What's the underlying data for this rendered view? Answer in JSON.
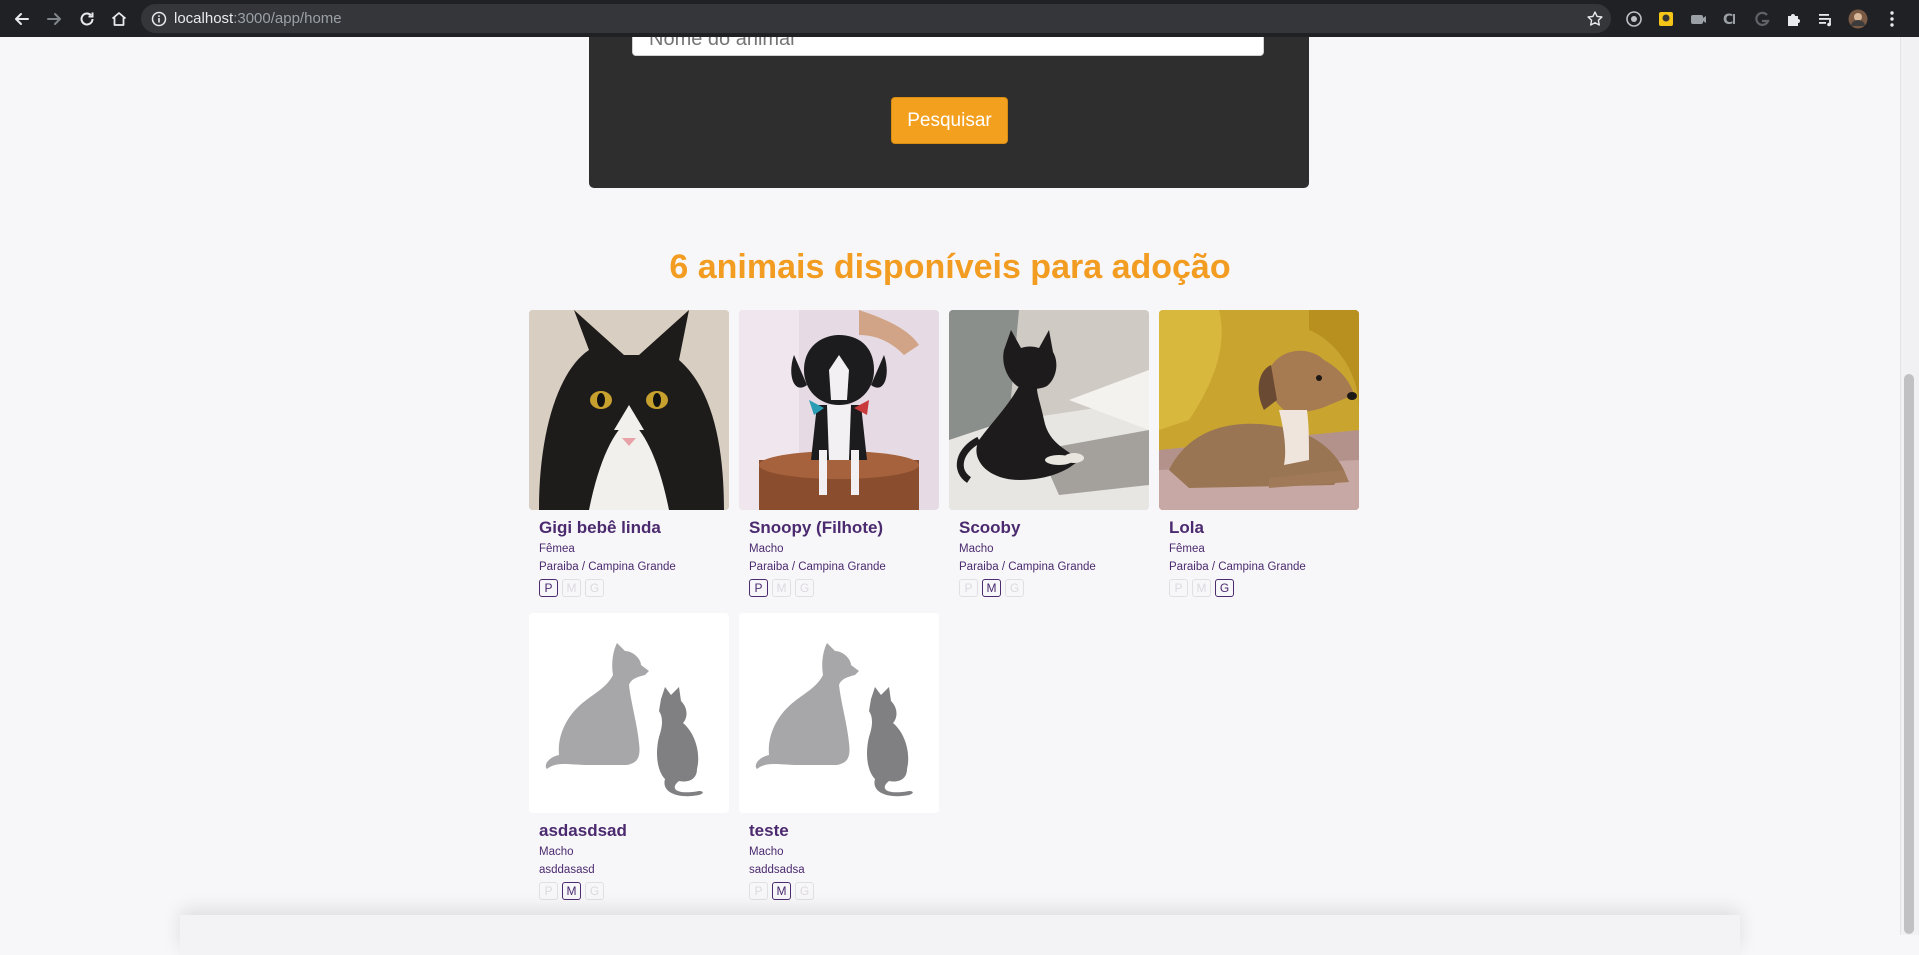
{
  "browser": {
    "url_host": "localhost",
    "url_path": ":3000/app/home"
  },
  "search": {
    "placeholder": "Nome do animal",
    "button_label": "Pesquisar"
  },
  "heading": "6 animais disponíveis para adoção",
  "pets": [
    {
      "name": "Gigi bebê linda",
      "sex": "Fêmea",
      "location": "Paraiba / Campina Grande",
      "size": "P",
      "photo": "black-white-kitten"
    },
    {
      "name": "Snoopy (Filhote)",
      "sex": "Macho",
      "location": "Paraiba / Campina Grande",
      "size": "P",
      "photo": "black-white-puppy"
    },
    {
      "name": "Scooby",
      "sex": "Macho",
      "location": "Paraiba / Campina Grande",
      "size": "M",
      "photo": "black-kitten"
    },
    {
      "name": "Lola",
      "sex": "Fêmea",
      "location": "Paraiba / Campina Grande",
      "size": "G",
      "photo": "brown-dog"
    },
    {
      "name": "asdasdsad",
      "sex": "Macho",
      "location": "asddasasd",
      "size": "M",
      "photo": "placeholder-dog-cat"
    },
    {
      "name": "teste",
      "sex": "Macho",
      "location": "saddsadsa",
      "size": "M",
      "photo": "placeholder-dog-cat"
    }
  ],
  "size_labels": [
    "P",
    "M",
    "G"
  ],
  "colors": {
    "accent": "#f29d22",
    "text_purple": "#4b2a6f",
    "panel": "#2e2e2e",
    "chrome": "#202124"
  }
}
